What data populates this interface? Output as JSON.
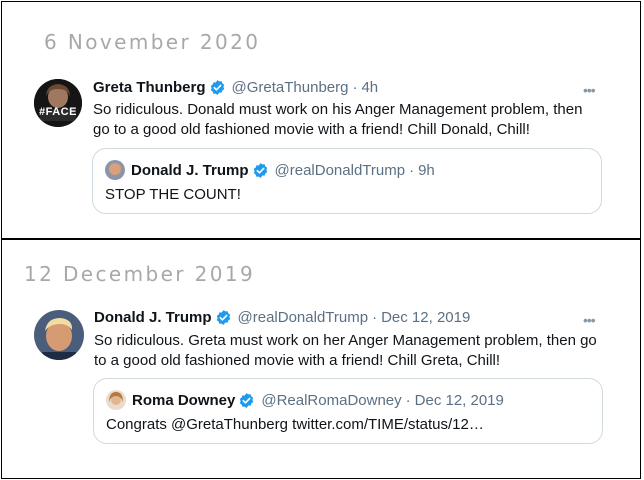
{
  "panels": [
    {
      "date": "6 November 2020",
      "tweet": {
        "name": "Greta Thunberg",
        "handle": "@GretaThunberg",
        "time": "4h",
        "text_line1": "So ridiculous. Donald must work on his Anger Management problem, then",
        "text_line2": "go to a good old fashioned movie with a friend! Chill Donald, Chill!",
        "avatar_text": "#FACE"
      },
      "quote": {
        "name": "Donald J. Trump",
        "handle": "@realDonaldTrump",
        "time": "9h",
        "text": "STOP THE COUNT!"
      }
    },
    {
      "date": "12 December 2019",
      "tweet": {
        "name": "Donald J. Trump",
        "handle": "@realDonaldTrump",
        "time": "Dec 12, 2019",
        "text_line1": "So ridiculous. Greta must work on her Anger Management problem, then go",
        "text_line2": "to a good old fashioned movie with a friend! Chill Greta, Chill!"
      },
      "quote": {
        "name": "Roma Downey",
        "handle": "@RealRomaDowney",
        "time": "Dec 12, 2019",
        "text": "Congrats @GretaThunberg twitter.com/TIME/status/12…"
      }
    }
  ],
  "ui": {
    "separator": "·",
    "more_glyph": "•••",
    "verified_color": "#1d9bf0"
  }
}
